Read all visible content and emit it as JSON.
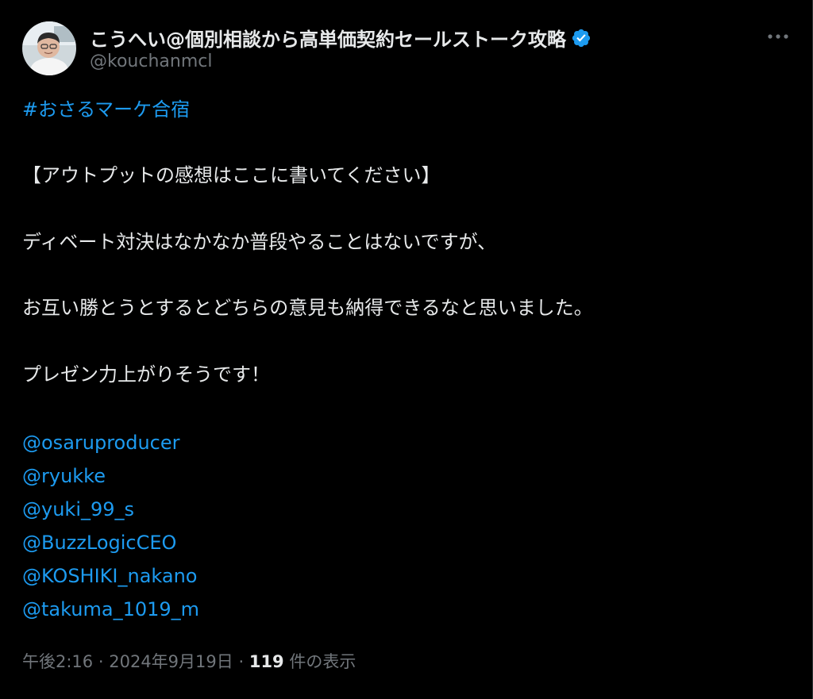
{
  "author": {
    "display_name": "こうへい@個別相談から高単価契約セールストーク攻略",
    "handle": "@kouchanmcl",
    "verified_icon": "verified-badge-icon"
  },
  "tweet": {
    "hashtag": "#おさるマーケ合宿",
    "lines": [
      "【アウトプットの感想はここに書いてください】",
      "ディベート対決はなかなか普段やることはないですが、",
      "お互い勝とうとするとどちらの意見も納得できるなと思いました。",
      "プレゼン力上がりそうです！"
    ],
    "mentions": [
      "@osaruproducer",
      "@ryukke",
      "@yuki_99_s",
      "@BuzzLogicCEO",
      "@KOSHIKI_nakano",
      "@takuma_1019_m"
    ]
  },
  "meta": {
    "time": "午後2:16",
    "separator": "·",
    "date": "2024年9月19日",
    "view_count": "119",
    "view_label": "件の表示"
  },
  "colors": {
    "background": "#000000",
    "text": "#e7e9ea",
    "link": "#1d9bf0",
    "secondary": "#71767b"
  }
}
